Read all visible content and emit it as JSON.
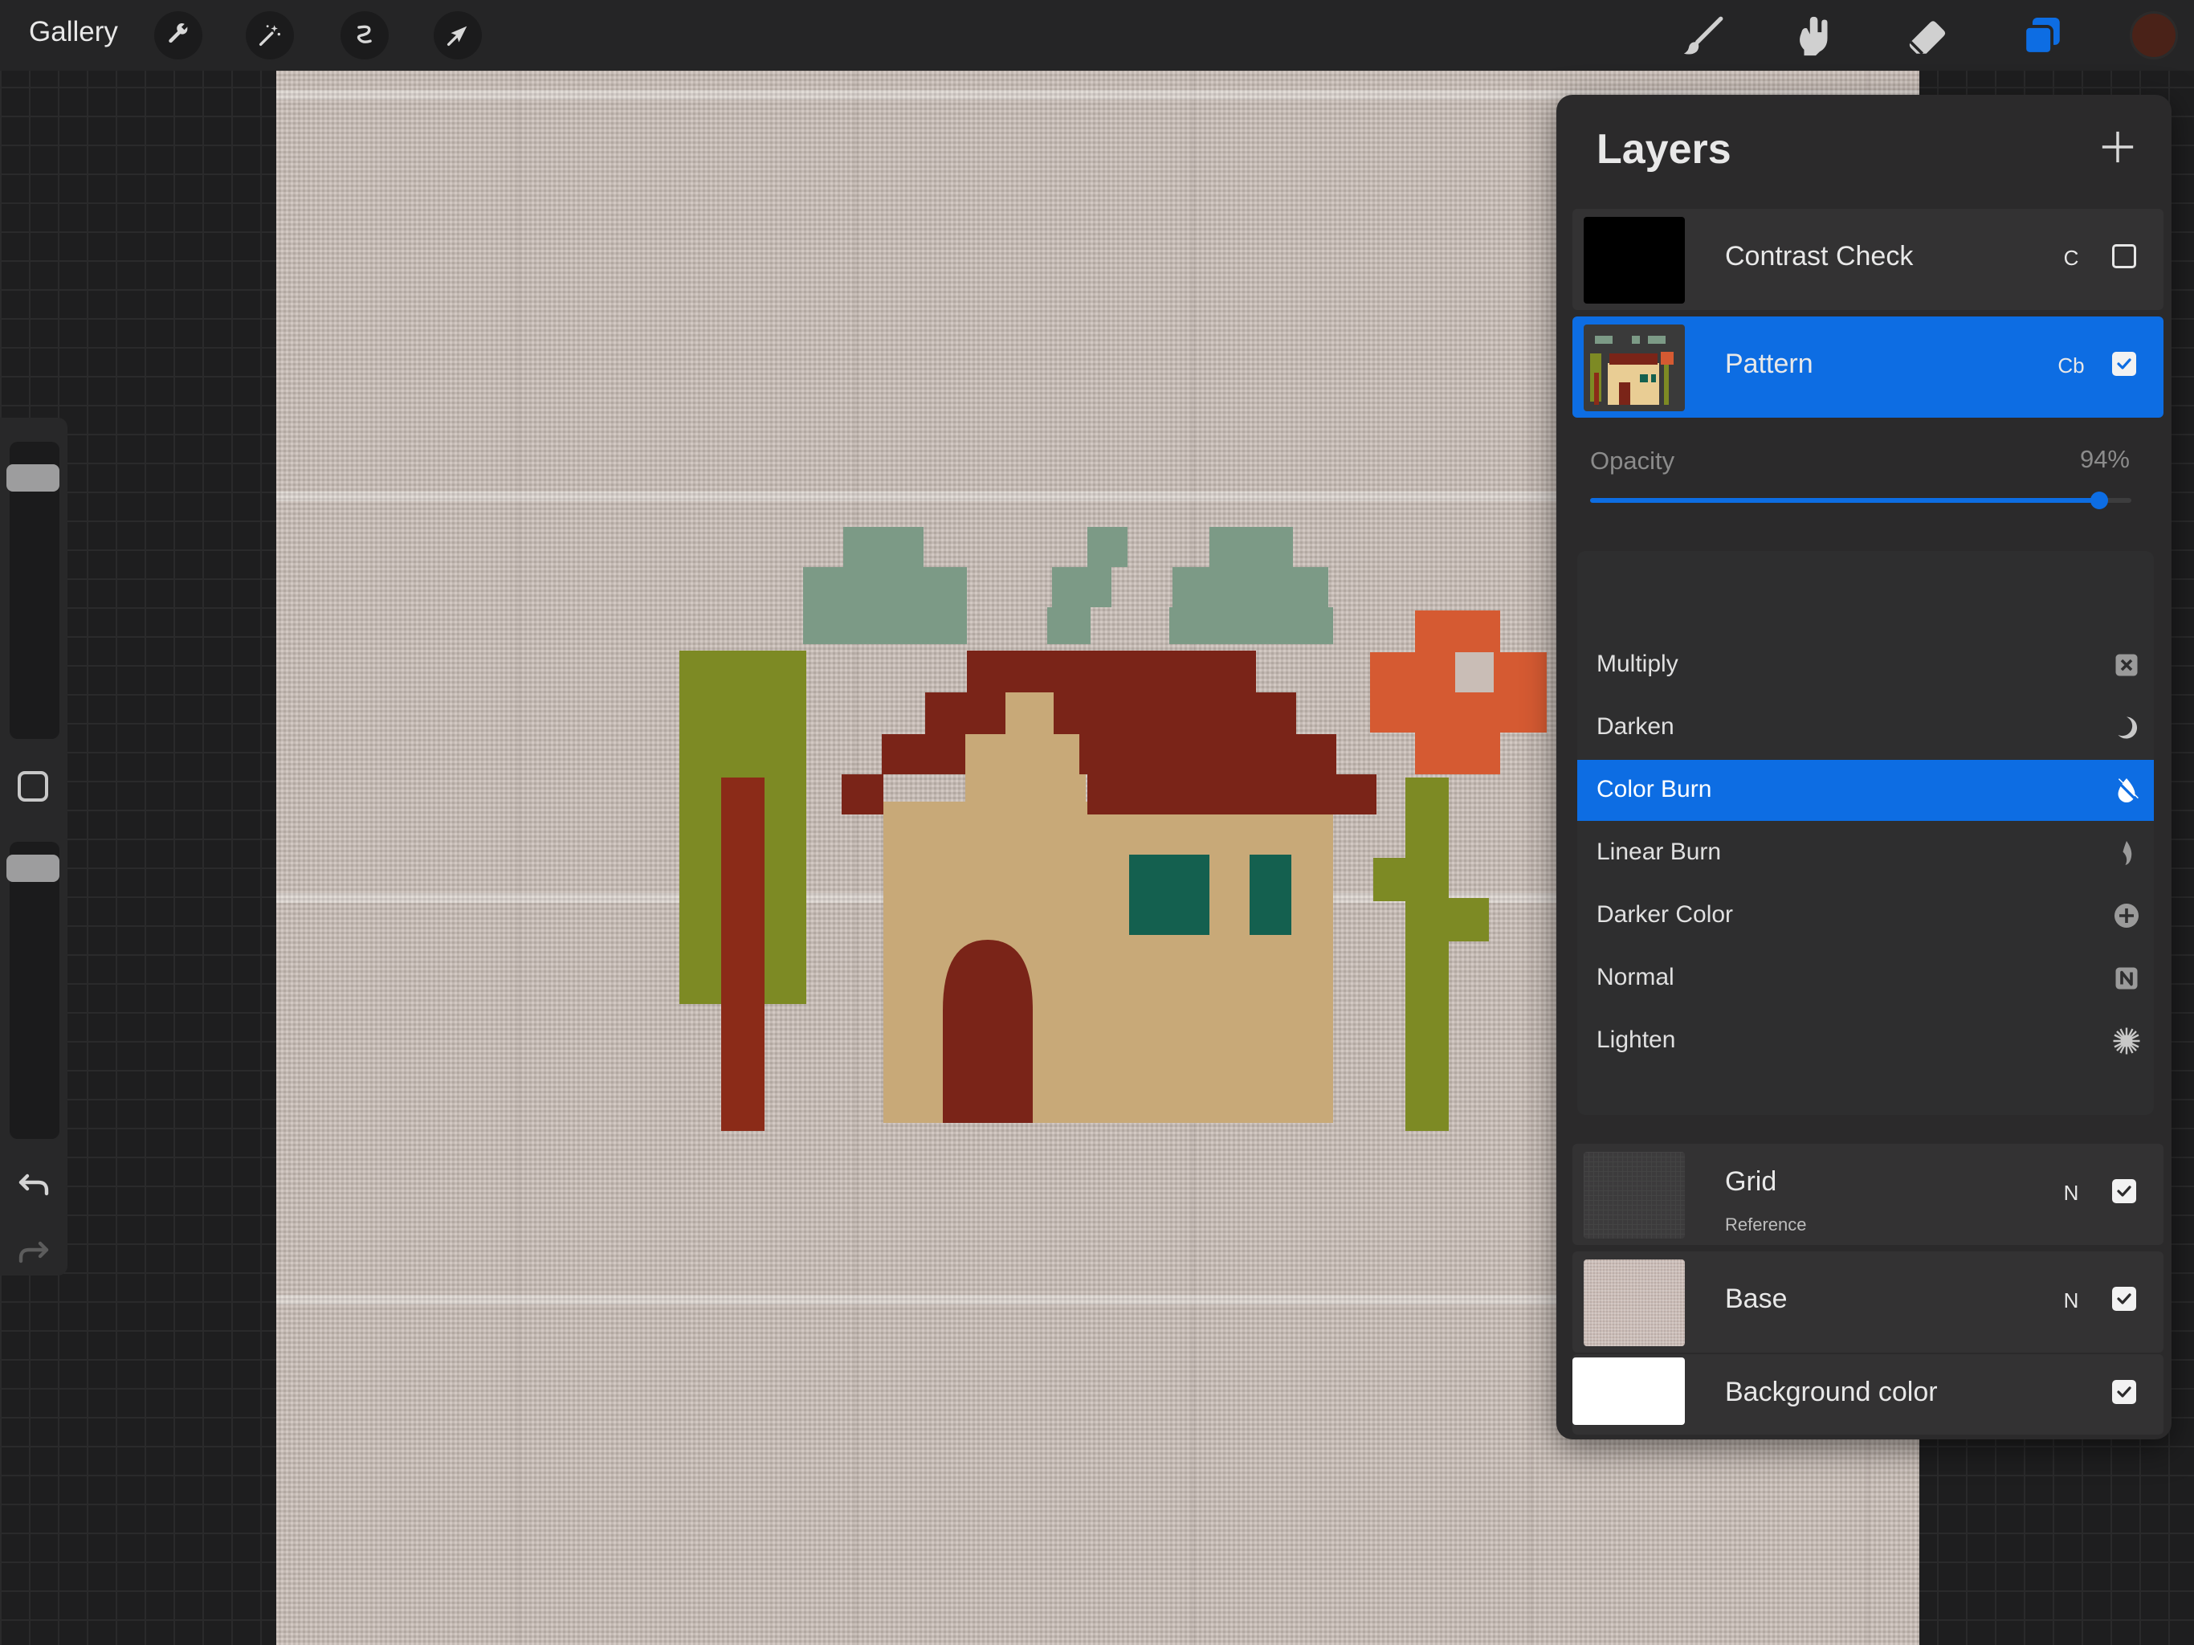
{
  "topbar": {
    "gallery_label": "Gallery",
    "left_tools": [
      "wrench-icon",
      "magic-wand-icon",
      "selection-icon",
      "transform-arrow-icon"
    ],
    "right_tools": [
      "brush-icon",
      "smudge-icon",
      "eraser-icon",
      "layers-icon"
    ],
    "current_color": "#4a2218"
  },
  "layers": {
    "title": "Layers",
    "items": [
      {
        "name": "Contrast Check",
        "mode": "C",
        "visible": false
      },
      {
        "name": "Pattern",
        "mode": "Cb",
        "visible": true,
        "selected": true
      },
      {
        "name": "Grid",
        "subtitle": "Reference",
        "mode": "N",
        "visible": true
      },
      {
        "name": "Base",
        "mode": "N",
        "visible": true
      },
      {
        "name": "Background color",
        "mode": "",
        "visible": true
      }
    ],
    "opacity_label": "Opacity",
    "opacity_value": "94%",
    "opacity_fraction": 0.94
  },
  "blend_modes": {
    "items": [
      {
        "label": "Multiply",
        "icon": "multiply-icon"
      },
      {
        "label": "Darken",
        "icon": "moon-icon"
      },
      {
        "label": "Color Burn",
        "icon": "burn-icon",
        "active": true
      },
      {
        "label": "Linear Burn",
        "icon": "flame-icon"
      },
      {
        "label": "Darker Color",
        "icon": "plus-circle-icon"
      },
      {
        "label": "Normal",
        "icon": "n-icon"
      },
      {
        "label": "Lighten",
        "icon": "sun-icon"
      }
    ]
  },
  "colors": {
    "accent": "#0d6de3",
    "panel": "#2b2a2b",
    "canvas_fabric": "#c9bdb6"
  }
}
